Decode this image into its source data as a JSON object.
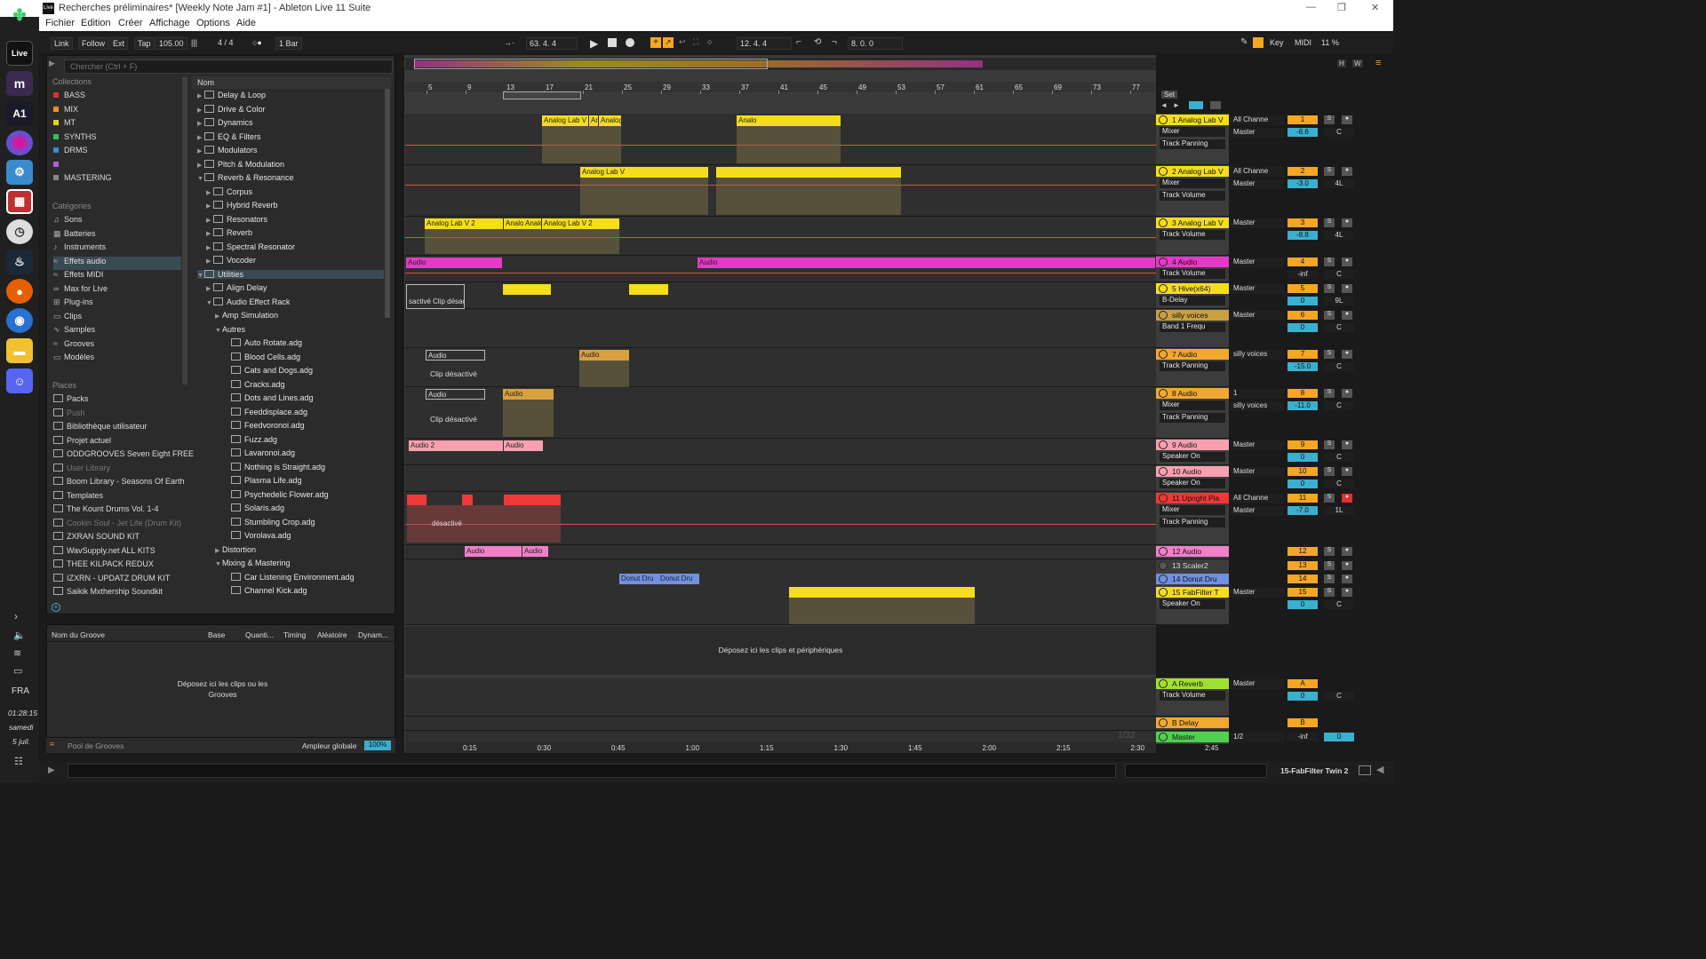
{
  "window": {
    "title": "Recherches préliminaires*  [Weekly Note Jam #1] - Ableton Live 11 Suite"
  },
  "menu": [
    "Fichier",
    "Edition",
    "Créer",
    "Affichage",
    "Options",
    "Aide"
  ],
  "transport": {
    "link": "Link",
    "follow": "Follow",
    "ext": "Ext",
    "tap": "Tap",
    "tempo": "105.00",
    "signature": "4 / 4",
    "quantize": "1 Bar",
    "position": "63.   4.   4",
    "loop_start": "12.   4.   4",
    "loop_length": "8.   0.   0",
    "key": "Key",
    "midi": "MIDI",
    "cpu": "11 %"
  },
  "sidebar": {
    "search_placeholder": "Chercher (Ctrl + F)",
    "collections_title": "Collections",
    "collections": [
      {
        "label": "BASS",
        "color": "#e03030"
      },
      {
        "label": "MIX",
        "color": "#f09020"
      },
      {
        "label": "MT",
        "color": "#e0d020"
      },
      {
        "label": "SYNTHS",
        "color": "#30c060"
      },
      {
        "label": "DRMS",
        "color": "#3090e0"
      },
      {
        "label": "",
        "color": "#b060e0"
      },
      {
        "label": "MASTERING",
        "color": "#888888"
      }
    ],
    "categories_title": "Catégories",
    "categories": [
      "Sons",
      "Batteries",
      "Instruments",
      "Effets audio",
      "Effets MIDI",
      "Max for Live",
      "Plug-ins",
      "Clips",
      "Samples",
      "Grooves",
      "Modèles"
    ],
    "places_title": "Places",
    "places": [
      "Packs",
      "Push",
      "Bibliothèque utilisateur",
      "Projet actuel",
      "ODDGROOVES Seven Eight FREE",
      "User Library",
      "Boom Library - Seasons Of Earth",
      "Templates",
      "The Kount Drums Vol. 1-4",
      "Cookin Soul - Jet Life (Drum Kit)",
      "ZXRAN SOUND KIT",
      "WavSupply.net ALL KITS",
      "THEE KILPACK REDUX",
      "IZXRN - UPDATZ DRUM KIT",
      "Saikik Mxthership Soundkit"
    ]
  },
  "browser": {
    "col_header": "Nom",
    "items": [
      {
        "label": "Delay & Loop",
        "indent": 0,
        "type": "folder",
        "open": false
      },
      {
        "label": "Drive & Color",
        "indent": 0,
        "type": "folder",
        "open": false
      },
      {
        "label": "Dynamics",
        "indent": 0,
        "type": "folder",
        "open": false
      },
      {
        "label": "EQ & Filters",
        "indent": 0,
        "type": "folder",
        "open": false
      },
      {
        "label": "Modulators",
        "indent": 0,
        "type": "folder",
        "open": false
      },
      {
        "label": "Pitch & Modulation",
        "indent": 0,
        "type": "folder",
        "open": false
      },
      {
        "label": "Reverb & Resonance",
        "indent": 0,
        "type": "folder",
        "open": true
      },
      {
        "label": "Corpus",
        "indent": 1,
        "type": "folder",
        "open": false
      },
      {
        "label": "Hybrid Reverb",
        "indent": 1,
        "type": "folder",
        "open": false
      },
      {
        "label": "Resonators",
        "indent": 1,
        "type": "folder",
        "open": false
      },
      {
        "label": "Reverb",
        "indent": 1,
        "type": "folder",
        "open": false
      },
      {
        "label": "Spectral Resonator",
        "indent": 1,
        "type": "folder",
        "open": false
      },
      {
        "label": "Vocoder",
        "indent": 1,
        "type": "folder",
        "open": false
      },
      {
        "label": "Utilities",
        "indent": 0,
        "type": "folder",
        "open": true,
        "selected": true
      },
      {
        "label": "Align Delay",
        "indent": 1,
        "type": "folder",
        "open": false
      },
      {
        "label": "Audio Effect Rack",
        "indent": 1,
        "type": "folder",
        "open": true
      },
      {
        "label": "Amp Simulation",
        "indent": 2,
        "type": "group",
        "open": false
      },
      {
        "label": "Autres",
        "indent": 2,
        "type": "group",
        "open": true
      },
      {
        "label": "Auto Rotate.adg",
        "indent": 3,
        "type": "file"
      },
      {
        "label": "Blood Cells.adg",
        "indent": 3,
        "type": "file"
      },
      {
        "label": "Cats and Dogs.adg",
        "indent": 3,
        "type": "file"
      },
      {
        "label": "Cracks.adg",
        "indent": 3,
        "type": "file"
      },
      {
        "label": "Dots and Lines.adg",
        "indent": 3,
        "type": "file"
      },
      {
        "label": "Feeddisplace.adg",
        "indent": 3,
        "type": "file"
      },
      {
        "label": "Feedvoronoi.adg",
        "indent": 3,
        "type": "file"
      },
      {
        "label": "Fuzz.adg",
        "indent": 3,
        "type": "file"
      },
      {
        "label": "Lavaronoi.adg",
        "indent": 3,
        "type": "file"
      },
      {
        "label": "Nothing is Straight.adg",
        "indent": 3,
        "type": "file"
      },
      {
        "label": "Plasma Life.adg",
        "indent": 3,
        "type": "file"
      },
      {
        "label": "Psychedelic Flower.adg",
        "indent": 3,
        "type": "file"
      },
      {
        "label": "Solaris.adg",
        "indent": 3,
        "type": "file"
      },
      {
        "label": "Stumbling Crop.adg",
        "indent": 3,
        "type": "file"
      },
      {
        "label": "Vorolava.adg",
        "indent": 3,
        "type": "file"
      },
      {
        "label": "Distortion",
        "indent": 2,
        "type": "group",
        "open": false
      },
      {
        "label": "Mixing & Mastering",
        "indent": 2,
        "type": "group",
        "open": true
      },
      {
        "label": "Car Listening Environment.adg",
        "indent": 3,
        "type": "file"
      },
      {
        "label": "Channel Kick.adg",
        "indent": 3,
        "type": "file"
      }
    ]
  },
  "groove": {
    "headers": [
      "Nom du Groove",
      "Base",
      "Quanti...",
      "Timing",
      "Aléatoire",
      "Dynam..."
    ],
    "drop_text": "Déposez ici les clips ou les Grooves",
    "pool": "Pool de Grooves",
    "global_label": "Ampleur globale",
    "global_value": "100%"
  },
  "timeline": {
    "bars": [
      "5",
      "9",
      "13",
      "17",
      "21",
      "25",
      "29",
      "33",
      "37",
      "41",
      "45",
      "49",
      "53",
      "57",
      "61",
      "65",
      "69",
      "73",
      "77"
    ],
    "times": [
      "0:15",
      "0:30",
      "0:45",
      "1:00",
      "1:15",
      "1:30",
      "1:45",
      "2:00",
      "2:15",
      "2:30",
      "2:45"
    ],
    "set_label": "Set",
    "drop_text": "Déposez ici les clips et périphériques",
    "page": "1/32"
  },
  "tracks": [
    {
      "name": "1 Analog Lab V",
      "color": "#f4dd1c",
      "input": "All Channe",
      "d1": "Mixer",
      "d2": "Track Panning",
      "out": "Master",
      "num": "1",
      "vol": "-8.6",
      "pan": "C"
    },
    {
      "name": "2 Analog Lab V",
      "color": "#f4dd1c",
      "input": "All Channe",
      "d1": "Mixer",
      "d2": "Track Volume",
      "out": "Master",
      "num": "2",
      "vol": "-3.0",
      "pan": "4L"
    },
    {
      "name": "3 Analog Lab V",
      "color": "#f4dd1c",
      "d1": "Track Volume",
      "out": "Master",
      "num": "3",
      "vol": "-8.8",
      "pan": "4L"
    },
    {
      "name": "4 Audio",
      "color": "#e838c8",
      "d1": "Track Volume",
      "out": "Master",
      "num": "4",
      "vol": "-inf",
      "pan": "C"
    },
    {
      "name": "5 Hive(x64)",
      "color": "#f4dd1c",
      "d1": "B-Delay",
      "out": "Master",
      "num": "5",
      "vol": "0",
      "pan": "9L"
    },
    {
      "name": "silly voices",
      "color": "#c8a040",
      "d1": "Band 1 Frequ",
      "out": "Master",
      "num": "6",
      "vol": "0",
      "pan": "C"
    },
    {
      "name": "7 Audio",
      "color": "#f0a830",
      "d1": "Track Panning",
      "out": "silly voices",
      "num": "7",
      "vol": "-15.0",
      "pan": "C"
    },
    {
      "name": "8 Audio",
      "color": "#f0a830",
      "input": "1",
      "d1": "Mixer",
      "d2": "Track Panning",
      "out": "silly voices",
      "num": "8",
      "vol": "-11.0",
      "pan": "C"
    },
    {
      "name": "9 Audio",
      "color": "#f8a0b0",
      "d1": "Speaker On",
      "out": "Master",
      "num": "9",
      "vol": "0",
      "pan": "C"
    },
    {
      "name": "10 Audio",
      "color": "#f8a0b0",
      "d1": "Speaker On",
      "out": "Master",
      "num": "10",
      "vol": "0",
      "pan": "C"
    },
    {
      "name": "11 Upright Pia",
      "color": "#f03838",
      "input": "All Channe",
      "d1": "Mixer",
      "d2": "Track Panning",
      "out": "Master",
      "num": "11",
      "vol": "-7.0",
      "pan": "1L"
    },
    {
      "name": "12 Audio",
      "color": "#f080c8",
      "num": "12"
    },
    {
      "name": "13 Scaler2",
      "color": "#3c3c3c",
      "num": "13"
    },
    {
      "name": "14 Donut Dru",
      "color": "#7090e0",
      "num": "14"
    },
    {
      "name": "15 FabFilter T",
      "color": "#f4dd1c",
      "d1": "Speaker On",
      "out": "Master",
      "num": "15",
      "vol": "0",
      "pan": "C"
    }
  ],
  "returns": [
    {
      "name": "A Reverb",
      "color": "#a0e030",
      "d1": "Track Volume",
      "out": "Master",
      "num": "A",
      "vol": "0",
      "pan": "C"
    },
    {
      "name": "B Delay",
      "color": "#f0a830",
      "num": "B"
    },
    {
      "name": "Master",
      "color": "#50d050",
      "out": "1/2",
      "num": "-inf",
      "vol": "0"
    }
  ],
  "clips": {
    "c1a": "Analog Lab V",
    "c1b": "Analog Lab V",
    "c1c": "Analog Lab V",
    "c1d": "Analo",
    "c2a": "Analog Lab V",
    "c3a": "Analog Lab V 2",
    "c3b": "Analog Lab V 2",
    "c3c": "Analog",
    "c4a": "Audio",
    "c4b": "Audio",
    "c5a": "sactivé Clip désactivé",
    "c7a": "Audio",
    "c7b": "Clip désactivé",
    "c7c": "Audio",
    "c8a": "Audio",
    "c8b": "Clip désactivé",
    "c8c": "Audio",
    "c9a": "Audio 2",
    "c9b": "Audio",
    "c11a": "désactivé",
    "c12a": "Audio",
    "c12b": "Audio",
    "c14a": "Donut Dru",
    "c14b": "Donut Dru"
  },
  "status": {
    "track": "15-FabFilter Twin 2"
  },
  "clock": {
    "lang": "FRA",
    "time": "01:28:15",
    "day": "samedi",
    "date": "5 juil."
  }
}
